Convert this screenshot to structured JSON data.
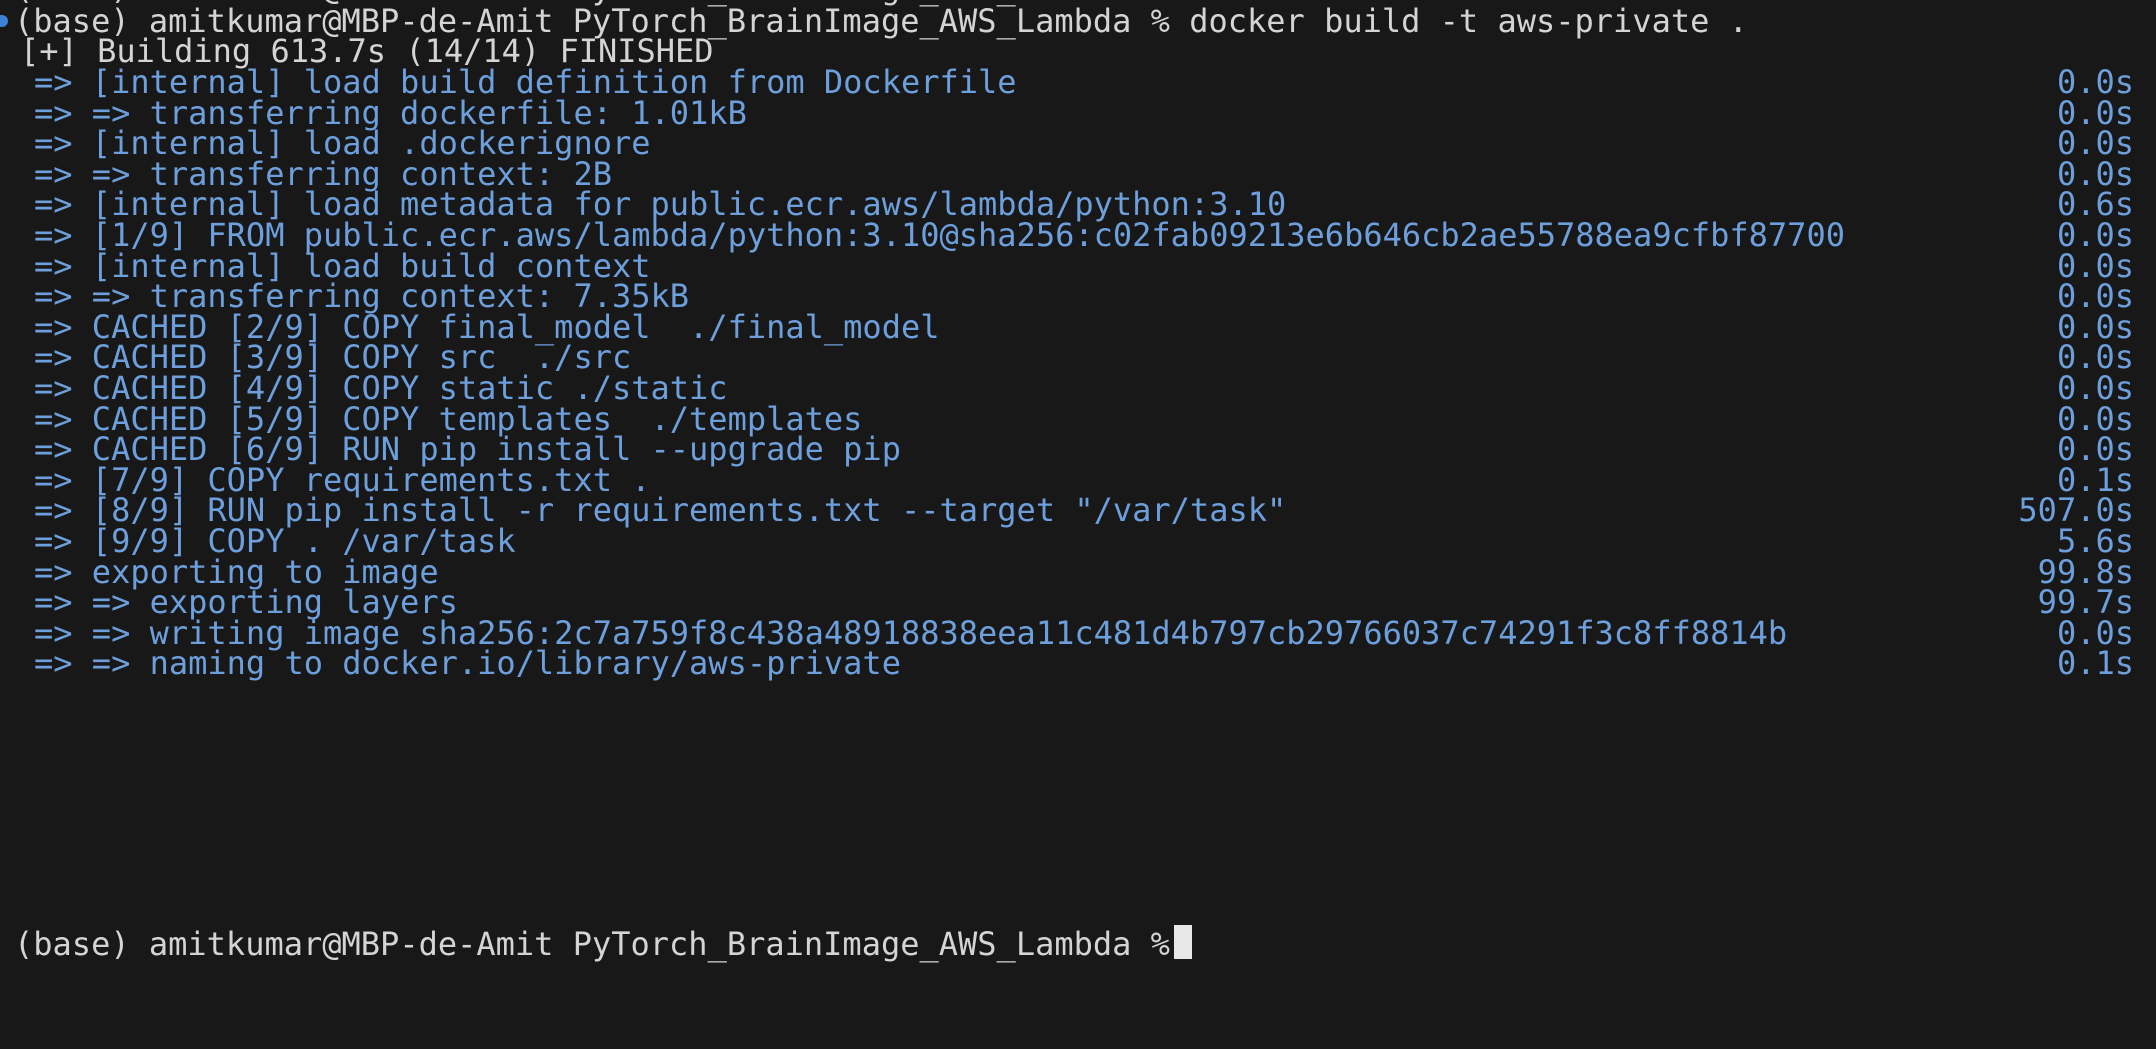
{
  "terminal": {
    "top_cropped_text": "(base) amitkumar@MBP-de-Amit PyTorch_BrainImage_AWS_Lambda %",
    "command_line": "(base) amitkumar@MBP-de-Amit PyTorch_BrainImage_AWS_Lambda % docker build -t aws-private .",
    "build_header": "[+] Building 613.7s (14/14) FINISHED",
    "steps": [
      {
        "text": "=> [internal] load build definition from Dockerfile",
        "time": "0.0s"
      },
      {
        "text": "=> => transferring dockerfile: 1.01kB",
        "time": "0.0s"
      },
      {
        "text": "=> [internal] load .dockerignore",
        "time": "0.0s"
      },
      {
        "text": "=> => transferring context: 2B",
        "time": "0.0s"
      },
      {
        "text": "=> [internal] load metadata for public.ecr.aws/lambda/python:3.10",
        "time": "0.6s"
      },
      {
        "text": "=> [1/9] FROM public.ecr.aws/lambda/python:3.10@sha256:c02fab09213e6b646cb2ae55788ea9cfbf87700",
        "time": "0.0s"
      },
      {
        "text": "=> [internal] load build context",
        "time": "0.0s"
      },
      {
        "text": "=> => transferring context: 7.35kB",
        "time": "0.0s"
      },
      {
        "text": "=> CACHED [2/9] COPY final_model  ./final_model",
        "time": "0.0s"
      },
      {
        "text": "=> CACHED [3/9] COPY src  ./src",
        "time": "0.0s"
      },
      {
        "text": "=> CACHED [4/9] COPY static ./static",
        "time": "0.0s"
      },
      {
        "text": "=> CACHED [5/9] COPY templates  ./templates",
        "time": "0.0s"
      },
      {
        "text": "=> CACHED [6/9] RUN pip install --upgrade pip",
        "time": "0.0s"
      },
      {
        "text": "=> [7/9] COPY requirements.txt .",
        "time": "0.1s"
      },
      {
        "text": "=> [8/9] RUN pip install -r requirements.txt --target \"/var/task\"",
        "time": "507.0s"
      },
      {
        "text": "=> [9/9] COPY . /var/task",
        "time": "5.6s"
      },
      {
        "text": "=> exporting to image",
        "time": "99.8s"
      },
      {
        "text": "=> => exporting layers",
        "time": "99.7s"
      },
      {
        "text": "=> => writing image sha256:2c7a759f8c438a48918838eea11c481d4b797cb29766037c74291f3c8ff8814b",
        "time": "0.0s"
      },
      {
        "text": "=> => naming to docker.io/library/aws-private",
        "time": "0.1s"
      }
    ],
    "bottom_prompt": "(base) amitkumar@MBP-de-Amit PyTorch_BrainImage_AWS_Lambda %",
    "colors": {
      "background": "#181818",
      "foreground": "#d4d4d4",
      "step_blue": "#6c9fdb",
      "prompt_marker": "#3b82d6"
    }
  }
}
